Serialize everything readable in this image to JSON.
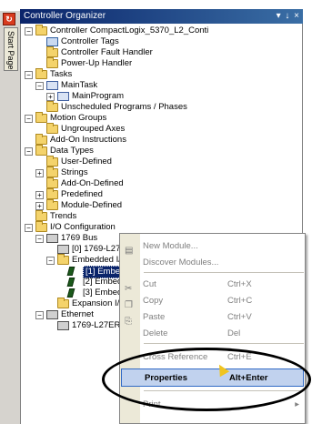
{
  "window": {
    "title": "Controller Organizer",
    "title_buttons": "▾ ↓ ×",
    "start_page_label": "Start Page"
  },
  "tree": [
    {
      "label": "Controller CompactLogix_5370_L2_Conti",
      "icon": "folder",
      "expander": "−"
    },
    {
      "label": "Controller Tags",
      "icon": "tag"
    },
    {
      "label": "Controller Fault Handler",
      "icon": "folder"
    },
    {
      "label": "Power-Up Handler",
      "icon": "folder"
    },
    {
      "label": "Tasks",
      "icon": "folder",
      "expander": "−"
    },
    {
      "label": "MainTask",
      "icon": "task",
      "expander": "−"
    },
    {
      "label": "MainProgram",
      "icon": "task",
      "expander": "+"
    },
    {
      "label": "Unscheduled Programs / Phases",
      "icon": "folder"
    },
    {
      "label": "Motion Groups",
      "icon": "folder",
      "expander": "−"
    },
    {
      "label": "Ungrouped Axes",
      "icon": "folder"
    },
    {
      "label": "Add-On Instructions",
      "icon": "folder"
    },
    {
      "label": "Data Types",
      "icon": "folder",
      "expander": "−"
    },
    {
      "label": "User-Defined",
      "icon": "folder"
    },
    {
      "label": "Strings",
      "icon": "folder",
      "expander": "+"
    },
    {
      "label": "Add-On-Defined",
      "icon": "folder"
    },
    {
      "label": "Predefined",
      "icon": "folder",
      "expander": "+"
    },
    {
      "label": "Module-Defined",
      "icon": "folder",
      "expander": "+"
    },
    {
      "label": "Trends",
      "icon": "folder"
    },
    {
      "label": "I/O Configuration",
      "icon": "folder",
      "expander": "−"
    },
    {
      "label": "1769 Bus",
      "icon": "module",
      "expander": "−"
    },
    {
      "label": "[0] 1769-L27ERM-QBFC1B Compa",
      "icon": "module"
    },
    {
      "label": "Embedded I/O",
      "icon": "folder",
      "expander": "−"
    },
    {
      "label": "[1] Embedded Discrete_IO",
      "icon": "io",
      "selected": true
    },
    {
      "label": "[2] Embedded",
      "icon": "io"
    },
    {
      "label": "[3] Embedded",
      "icon": "io"
    },
    {
      "label": "Expansion I/O",
      "icon": "folder"
    },
    {
      "label": "Ethernet",
      "icon": "module",
      "expander": "−"
    },
    {
      "label": "1769-L27ERM-QB",
      "icon": "module"
    }
  ],
  "context_menu": {
    "items": [
      {
        "label": "New Module...",
        "shortcut": "",
        "icon": "▤"
      },
      {
        "label": "Discover Modules...",
        "shortcut": "",
        "icon": ""
      },
      {
        "label": "Cut",
        "shortcut": "Ctrl+X",
        "icon": "✂"
      },
      {
        "label": "Copy",
        "shortcut": "Ctrl+C",
        "icon": "❐"
      },
      {
        "label": "Paste",
        "shortcut": "Ctrl+V",
        "icon": "⎘"
      },
      {
        "label": "Delete",
        "shortcut": "Del",
        "icon": ""
      },
      {
        "label": "Cross Reference",
        "shortcut": "Ctrl+E",
        "icon": ""
      },
      {
        "label": "Properties",
        "shortcut": "Alt+Enter",
        "icon": ""
      },
      {
        "label": "Print",
        "shortcut": "",
        "icon": "",
        "submenu": "▸"
      }
    ]
  },
  "colors": {
    "title_bar": "#0a246a",
    "selection": "#0a246a",
    "menu_hover": "#c1d2ee",
    "folder": "#f4d36b"
  }
}
